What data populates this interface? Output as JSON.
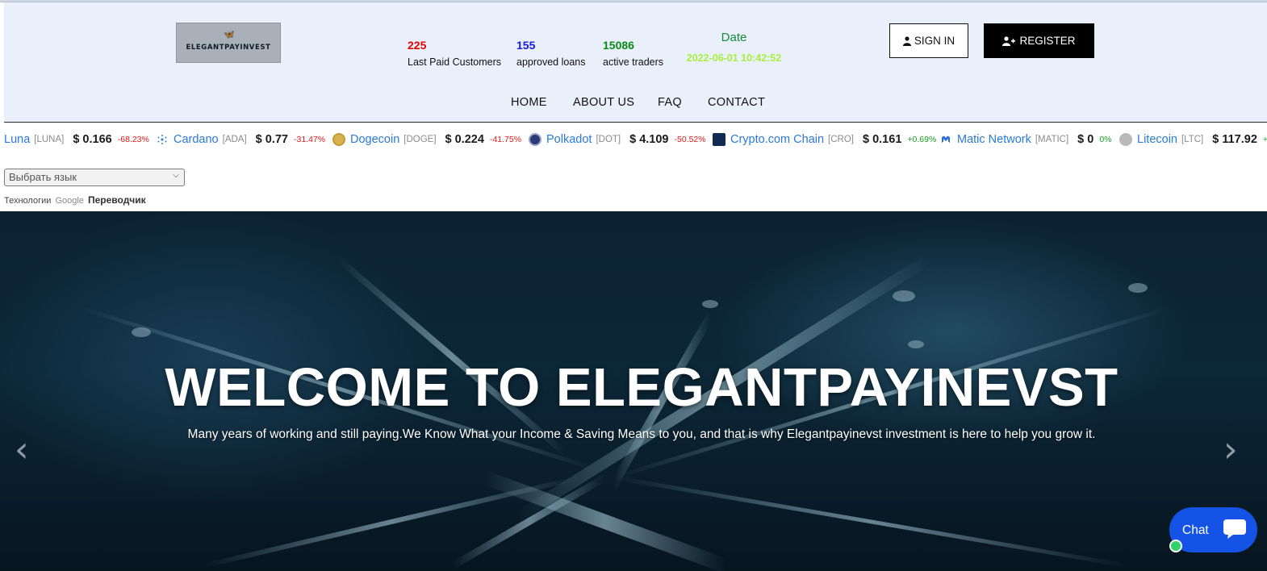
{
  "logo": {
    "mark": "🦋",
    "text": "ELEGANTPAYINVEST"
  },
  "stats": [
    {
      "value": "225",
      "label": "Last Paid Customers"
    },
    {
      "value": "155",
      "label": "approved loans"
    },
    {
      "value": "15086",
      "label": "active traders"
    }
  ],
  "date": {
    "title": "Date",
    "value": "2022-06-01 10:42:52"
  },
  "buttons": {
    "sign_in": "SIGN IN",
    "register": "REGISTER"
  },
  "nav": [
    "HOME",
    "ABOUT US",
    "FAQ",
    "CONTACT"
  ],
  "ticker": [
    {
      "name": "Luna",
      "symbol": "[LUNA]",
      "price": "$ 0.166",
      "change": "-68.23%",
      "direction": "down",
      "icon": "none"
    },
    {
      "name": "Cardano",
      "symbol": "[ADA]",
      "price": "$ 0.77",
      "change": "-31.47%",
      "direction": "down",
      "icon": "cardano-icon"
    },
    {
      "name": "Dogecoin",
      "symbol": "[DOGE]",
      "price": "$ 0.224",
      "change": "-41.75%",
      "direction": "down",
      "icon": "dogecoin-icon"
    },
    {
      "name": "Polkadot",
      "symbol": "[DOT]",
      "price": "$ 4.109",
      "change": "-50.52%",
      "direction": "down",
      "icon": "polkadot-icon"
    },
    {
      "name": "Crypto.com Chain",
      "symbol": "[CRO]",
      "price": "$ 0.161",
      "change": "+0.69%",
      "direction": "up",
      "icon": "cro-icon"
    },
    {
      "name": "Matic Network",
      "symbol": "[MATIC]",
      "price": "$ 0",
      "change": "0%",
      "direction": "up",
      "icon": "matic-icon"
    },
    {
      "name": "Litecoin",
      "symbol": "[LTC]",
      "price": "$ 117.92",
      "change": "+",
      "direction": "up",
      "icon": "litecoin-icon"
    }
  ],
  "translate": {
    "select_label": "Выбрать язык",
    "powered_prefix": "Технологии",
    "powered_brand": "Google",
    "powered_suffix": "Переводчик"
  },
  "hero": {
    "title": "WELCOME TO ELEGANTPAYINEVST",
    "subtitle": "Many years of working and still paying.We Know What your Income & Saving Means to you, and that is why Elegantpayinevst investment is here to help you grow it."
  },
  "chat": {
    "label": "Chat"
  },
  "colors": {
    "header_bg": "#eaf0fb",
    "stat_red": "#e60000",
    "stat_blue": "#1717e6",
    "stat_green": "#0a8a16",
    "date_value": "#a6ef3a",
    "chat_bg": "#1552e6",
    "ticker_name": "#2a7ad6"
  }
}
